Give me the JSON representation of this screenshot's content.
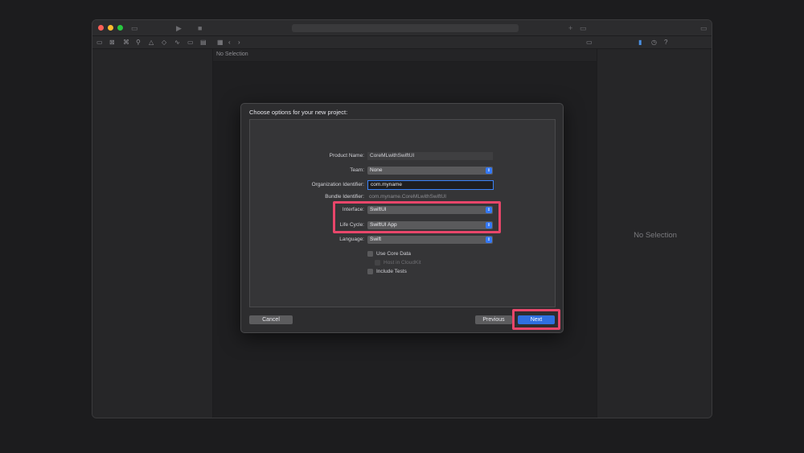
{
  "editor": {
    "no_selection": "No Selection"
  },
  "inspector": {
    "no_selection": "No Selection"
  },
  "sheet": {
    "title": "Choose options for your new project:",
    "product_name": {
      "label": "Product Name:",
      "value": "CoreMLwithSwiftUI"
    },
    "team": {
      "label": "Team:",
      "value": "None"
    },
    "organization_identifier": {
      "label": "Organization Identifier:",
      "value": "com.myname"
    },
    "bundle_identifier": {
      "label": "Bundle Identifier:",
      "value": "com.myname.CoreMLwithSwiftUI"
    },
    "interface": {
      "label": "Interface:",
      "value": "SwiftUI"
    },
    "life_cycle": {
      "label": "Life Cycle:",
      "value": "SwiftUI App"
    },
    "language": {
      "label": "Language:",
      "value": "Swift"
    },
    "use_core_data": {
      "label": "Use Core Data",
      "checked": false
    },
    "host_in_cloudkit": {
      "label": "Host in CloudKit",
      "checked": false,
      "disabled": true
    },
    "include_tests": {
      "label": "Include Tests",
      "checked": false
    },
    "buttons": {
      "cancel": "Cancel",
      "previous": "Previous",
      "next": "Next"
    }
  },
  "colors": {
    "highlight": "#e8466a",
    "accent": "#3478f6",
    "primary_button": "#2f6fe0"
  }
}
